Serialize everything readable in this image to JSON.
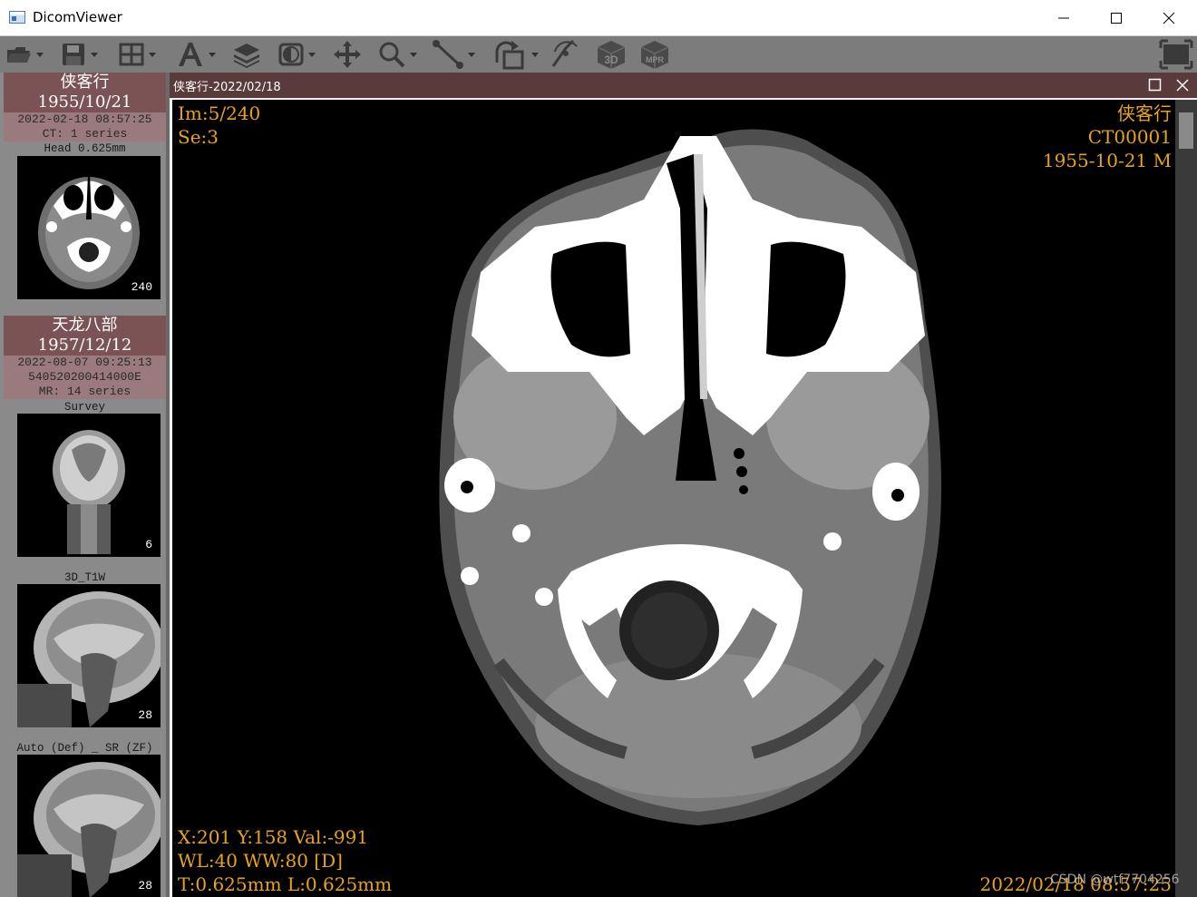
{
  "window": {
    "title": "DicomViewer"
  },
  "toolbar": {
    "tools": [
      "open-icon",
      "save-icon",
      "layout-grid-icon",
      "annotation-text-icon",
      "layers-icon",
      "window-level-icon",
      "pan-icon",
      "zoom-icon",
      "measure-icon",
      "rotate-icon",
      "cine-icon",
      "3d-icon",
      "mpr-icon",
      "fullscreen-icon"
    ],
    "labels": {
      "3d": "3D",
      "mpr": "MPR"
    }
  },
  "sidebar": {
    "patients": [
      {
        "name": "侠客行",
        "dob": "1955/10/21",
        "study_datetime": "2022-02-18 08:57:25",
        "modality_info": "CT: 1 series",
        "series": [
          {
            "label": "Head 0.625mm",
            "count": "240"
          }
        ]
      },
      {
        "name": "天龙八部",
        "dob": "1957/12/12",
        "study_datetime": "2022-08-07 09:25:13",
        "study_id": "540520200414000E",
        "modality_info": "MR: 14 series",
        "series": [
          {
            "label": "Survey",
            "count": "6"
          },
          {
            "label": "3D_T1W",
            "count": "28"
          },
          {
            "label": "Auto (Def) _ SR (ZF)",
            "count": "28"
          }
        ]
      }
    ]
  },
  "viewer": {
    "title": "侠客行-2022/02/18",
    "overlay": {
      "image_index": "Im:5/240",
      "series_index": "Se:3",
      "patient_name": "侠客行",
      "patient_id": "CT00001",
      "patient_dob_sex": "1955-10-21 M",
      "cursor": "X:201 Y:158 Val:-991",
      "window": "WL:40 WW:80 [D]",
      "thickness": "T:0.625mm L:0.625mm",
      "study_datetime": "2022/02/18 08:57:25"
    }
  },
  "watermark": "CSDN @wtf7704256",
  "colors": {
    "overlay_text": "#e8a417",
    "patient_header": "#7b5355",
    "viewer_header": "#5b3a3c",
    "toolbar": "#7c7c7c"
  }
}
